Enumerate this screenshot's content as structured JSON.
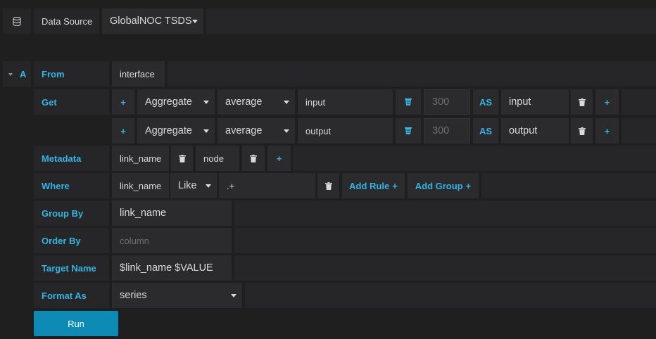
{
  "datasource": {
    "label": "Data Source",
    "selected": "GlobalNOC TSDS"
  },
  "query": {
    "ref_id": "A",
    "from": {
      "label": "From",
      "value": "interface"
    },
    "get": {
      "label": "Get",
      "rows": [
        {
          "agg_type": "Aggregate",
          "function": "average",
          "metric": "input",
          "bucket_placeholder": "300",
          "as_label": "AS",
          "alias": "input"
        },
        {
          "agg_type": "Aggregate",
          "function": "average",
          "metric": "output",
          "bucket_placeholder": "300",
          "as_label": "AS",
          "alias": "output"
        }
      ]
    },
    "metadata": {
      "label": "Metadata",
      "items": [
        "link_name",
        "node"
      ]
    },
    "where": {
      "label": "Where",
      "field": "link_name",
      "operator": "Like",
      "value": ".+",
      "add_rule": "Add Rule",
      "add_group": "Add Group"
    },
    "group_by": {
      "label": "Group By",
      "value": "link_name"
    },
    "order_by": {
      "label": "Order By",
      "placeholder": "column"
    },
    "target_name": {
      "label": "Target Name",
      "value": "$link_name $VALUE"
    },
    "format_as": {
      "label": "Format As",
      "value": "series"
    }
  },
  "run_button": "Run",
  "icons": {
    "database": "database-icon",
    "caret": "caret-down-icon",
    "plus": "plus-icon",
    "trash": "trash-icon",
    "bucket": "bucket-icon"
  },
  "colors": {
    "accent": "#33b5e5",
    "run": "#0e8bb5",
    "background": "#1f1f20"
  }
}
